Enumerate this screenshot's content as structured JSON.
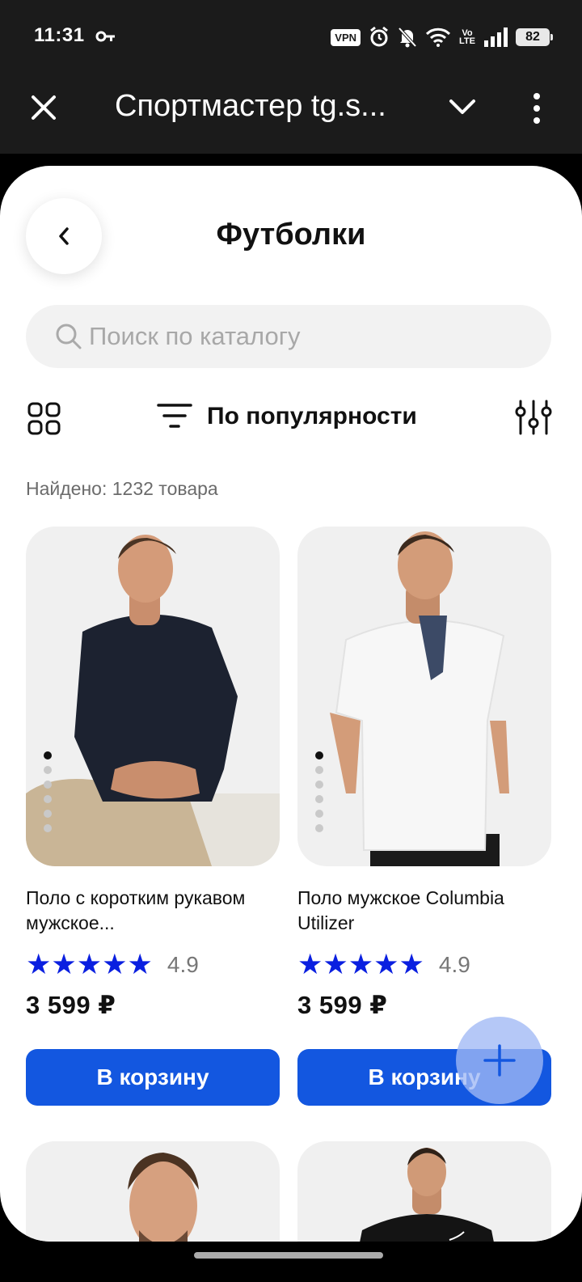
{
  "status_bar": {
    "time": "11:31",
    "vpn": "VPN",
    "volte_top": "Vo",
    "volte_bottom": "LTE",
    "battery": "82"
  },
  "title_bar": {
    "title": "Спортмастер tg.s..."
  },
  "header": {
    "title": "Футболки"
  },
  "search": {
    "placeholder": "Поиск по каталогу",
    "value": ""
  },
  "toolbar": {
    "sort_label": "По популярности"
  },
  "results": {
    "found_text": "Найдено: 1232 товара"
  },
  "products": [
    {
      "name": "Поло с коротким рукавом мужское...",
      "stars": "★★★★★",
      "rating": "4.9",
      "price": "3 599 ₽",
      "cart_label": "В корзину",
      "shirt_color": "#1c2230",
      "image_dot_count": 6
    },
    {
      "name": "Поло мужское Columbia Utilizer",
      "stars": "★★★★★",
      "rating": "4.9",
      "price": "3 599 ₽",
      "cart_label": "В корзину",
      "shirt_color": "#f7f7f7",
      "image_dot_count": 6
    }
  ],
  "colors": {
    "accent": "#1357e0",
    "stars": "#0a1fe0",
    "fab": "#a0b9f5"
  }
}
